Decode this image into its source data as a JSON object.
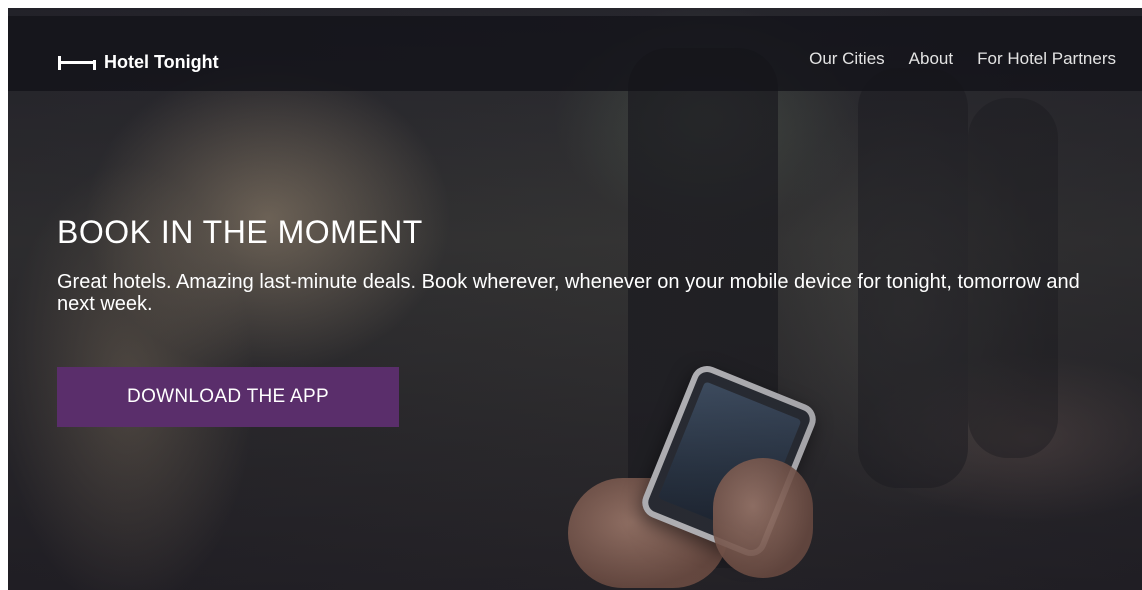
{
  "brand": {
    "name": "Hotel Tonight",
    "icon": "bed-logo-icon"
  },
  "nav": {
    "items": [
      {
        "label": "Our Cities"
      },
      {
        "label": "About"
      },
      {
        "label": "For Hotel Partners"
      }
    ]
  },
  "hero": {
    "title": "BOOK IN THE MOMENT",
    "subtitle": "Great hotels. Amazing last-minute deals. Book wherever, whenever on your mobile device for tonight, tomorrow and next week.",
    "cta_label": "DOWNLOAD THE APP"
  },
  "colors": {
    "accent": "#5a2e6b",
    "navbar": "#14141a",
    "text": "#ffffff"
  }
}
